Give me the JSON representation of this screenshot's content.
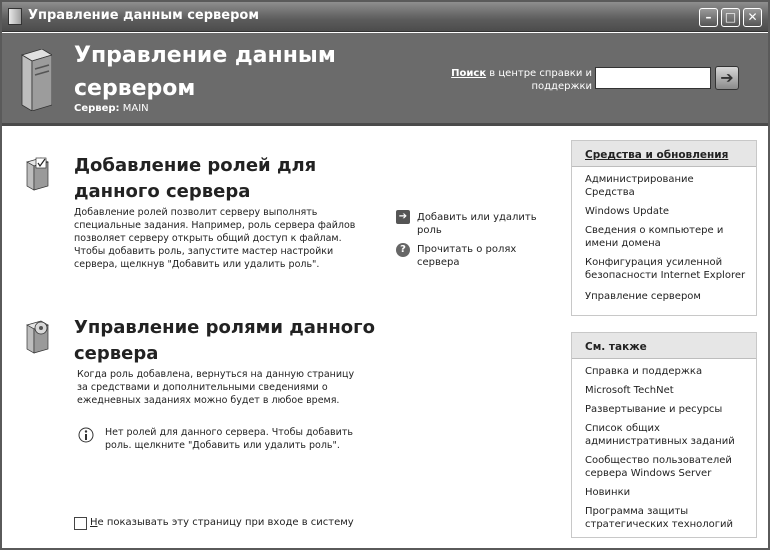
{
  "window": {
    "title": "Управление данным сервером"
  },
  "titlebar": {
    "minimize_glyph": "–",
    "maximize_glyph": "□",
    "close_glyph": "✕"
  },
  "header": {
    "title": "Управление данным сервером",
    "server_label": "Сервер:",
    "server_name": "MAIN",
    "search_link": "Поиск",
    "search_rest": " в центре справки и поддержки",
    "search_value": "",
    "go_glyph": "➔"
  },
  "roles_section": {
    "title": "Добавление ролей для данного сервера",
    "description": "Добавление ролей позволит серверу выполнять специальные задания. Например, роль сервера файлов позволяет серверу открыть общий доступ к файлам. Чтобы добавить роль, запустите мастер настройки сервера, щелкнув \"Добавить или удалить роль\".",
    "actions": [
      {
        "label": "Добавить или удалить роль",
        "icon": "arrow-right-icon"
      },
      {
        "label": "Прочитать о ролях сервера",
        "icon": "help-icon"
      }
    ]
  },
  "manage_section": {
    "title": "Управление ролями данного сервера",
    "description": "Когда роль добавлена, вернуться на данную страницу за средствами и дополнительными сведениями о ежедневных заданиях можно будет в любое время.",
    "info": "Нет ролей для данного сервера. Чтобы добавить роль. щелкните \"Добавить или удалить роль\"."
  },
  "footer": {
    "checkbox_label_underlined": "Н",
    "checkbox_label_rest": "е показывать эту страницу при входе в систему",
    "checked": false
  },
  "tools_panel": {
    "title": "Средства и обновления",
    "items": [
      "Администрирование Средства",
      "Windows Update",
      "Сведения о компьютере и имени домена",
      "Конфигурация усиленной безопасности Internet Explorer",
      "Управление сервером"
    ]
  },
  "see_also_panel": {
    "title": "См. также",
    "items": [
      "Справка и поддержка",
      "Microsoft TechNet",
      "Развертывание и ресурсы",
      "Список общих административных заданий",
      "Сообщество пользователей сервера Windows Server",
      "Новинки",
      "Программа защиты стратегических технологий"
    ]
  }
}
